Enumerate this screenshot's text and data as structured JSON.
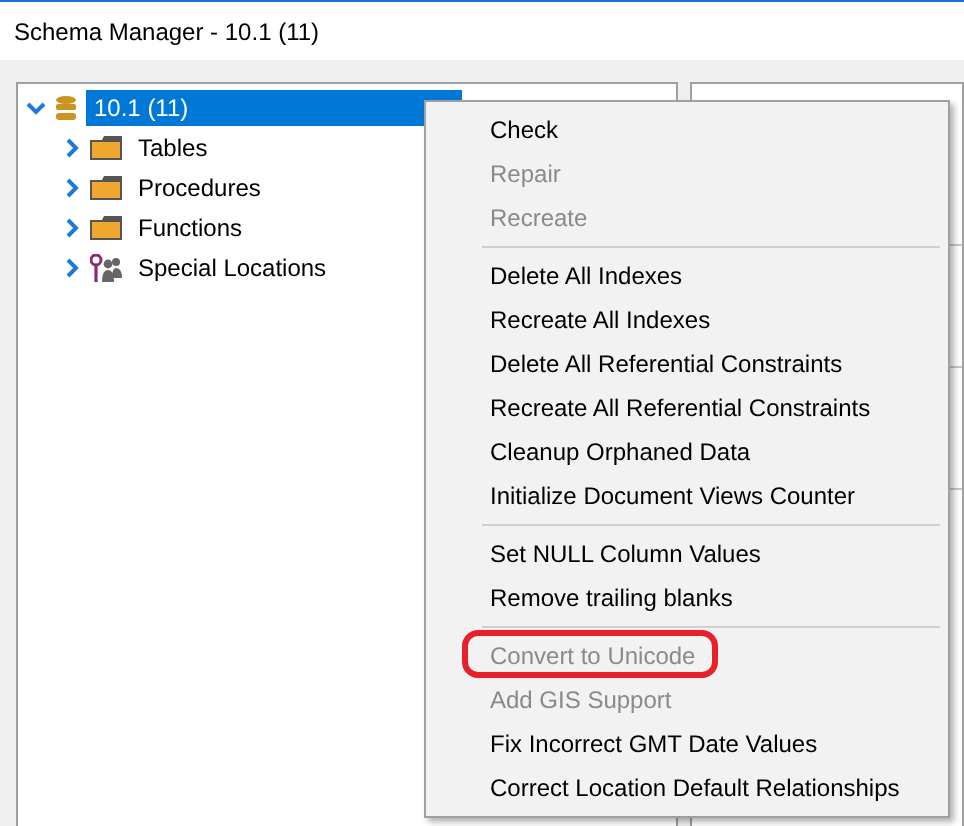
{
  "window": {
    "title": "Schema Manager - 10.1 (11)"
  },
  "tree": [
    {
      "label": "10.1 (11)",
      "kind": "database",
      "expanded": true,
      "selected": true,
      "children": [
        {
          "label": "Tables",
          "kind": "folder",
          "expanded": false,
          "selected": false
        },
        {
          "label": "Procedures",
          "kind": "folder",
          "expanded": false,
          "selected": false
        },
        {
          "label": "Functions",
          "kind": "folder",
          "expanded": false,
          "selected": false
        },
        {
          "label": "Special Locations",
          "kind": "locations",
          "expanded": false,
          "selected": false
        }
      ]
    }
  ],
  "context_menu": [
    {
      "kind": "item",
      "label": "Check",
      "disabled": false,
      "highlighted": false
    },
    {
      "kind": "item",
      "label": "Repair",
      "disabled": true,
      "highlighted": false
    },
    {
      "kind": "item",
      "label": "Recreate",
      "disabled": true,
      "highlighted": false
    },
    {
      "kind": "separator"
    },
    {
      "kind": "item",
      "label": "Delete All Indexes",
      "disabled": false,
      "highlighted": false
    },
    {
      "kind": "item",
      "label": "Recreate All Indexes",
      "disabled": false,
      "highlighted": false
    },
    {
      "kind": "item",
      "label": "Delete All Referential Constraints",
      "disabled": false,
      "highlighted": false
    },
    {
      "kind": "item",
      "label": "Recreate All Referential Constraints",
      "disabled": false,
      "highlighted": false
    },
    {
      "kind": "item",
      "label": "Cleanup Orphaned Data",
      "disabled": false,
      "highlighted": false
    },
    {
      "kind": "item",
      "label": "Initialize Document Views Counter",
      "disabled": false,
      "highlighted": false
    },
    {
      "kind": "separator"
    },
    {
      "kind": "item",
      "label": "Set NULL Column Values",
      "disabled": false,
      "highlighted": false
    },
    {
      "kind": "item",
      "label": "Remove trailing blanks",
      "disabled": false,
      "highlighted": false
    },
    {
      "kind": "separator"
    },
    {
      "kind": "item",
      "label": "Convert to Unicode",
      "disabled": true,
      "highlighted": true
    },
    {
      "kind": "item",
      "label": "Add GIS Support",
      "disabled": true,
      "highlighted": false
    },
    {
      "kind": "item",
      "label": "Fix Incorrect GMT Date Values",
      "disabled": false,
      "highlighted": false
    },
    {
      "kind": "item",
      "label": "Correct Location Default Relationships",
      "disabled": false,
      "highlighted": false
    }
  ]
}
